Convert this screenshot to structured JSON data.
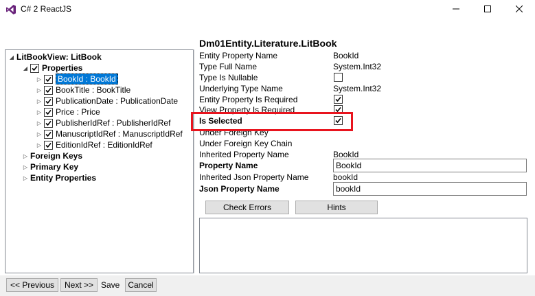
{
  "window": {
    "title": "C# 2 ReactJS",
    "app_icon": "visual-studio-icon",
    "controls": [
      "minimize-icon",
      "maximize-icon",
      "close-icon"
    ]
  },
  "tree": {
    "root_label": "LitBookView: LitBook",
    "properties_label": "Properties",
    "properties": [
      {
        "label": "BookId : BookId",
        "checked": true,
        "selected": true
      },
      {
        "label": "BookTitle : BookTitle",
        "checked": true
      },
      {
        "label": "PublicationDate : PublicationDate",
        "checked": true
      },
      {
        "label": "Price : Price",
        "checked": true
      },
      {
        "label": "PublisherIdRef : PublisherIdRef",
        "checked": true
      },
      {
        "label": "ManuscriptIdRef : ManuscriptIdRef",
        "checked": true
      },
      {
        "label": "EditionIdRef : EditionIdRef",
        "checked": true
      }
    ],
    "foreign_keys_label": "Foreign Keys",
    "primary_key_label": "Primary Key",
    "entity_properties_label": "Entity Properties"
  },
  "details": {
    "entity_title": "Dm01Entity.Literature.LitBook",
    "entity_property_name_label": "Entity Property Name",
    "entity_property_name_value": "BookId",
    "type_full_name_label": "Type Full Name",
    "type_full_name_value": "System.Int32",
    "type_is_nullable_label": "Type Is Nullable",
    "underlying_type_name_label": "Underlying Type Name",
    "underlying_type_name_value": "System.Int32",
    "entity_property_required_label": "Entity Property Is Required",
    "view_property_required_label": "View Property Is Required",
    "is_selected_label": "Is Selected",
    "under_foreign_key_label": "Under Foreign Key",
    "under_foreign_key_chain_label": "Under Foreign Key Chain",
    "inherited_property_name_label": "Inherited Property Name",
    "inherited_property_name_value": "BookId",
    "property_name_label": "Property Name",
    "property_name_value": "BookId",
    "inherited_json_property_name_label": "Inherited Json Property Name",
    "inherited_json_property_name_value": "bookId",
    "json_property_name_label": "Json Property Name",
    "json_property_name_value": "bookId"
  },
  "buttons": {
    "check_errors": "Check Errors",
    "hints": "Hints",
    "previous": "<< Previous",
    "next": "Next >>",
    "save": "Save",
    "cancel": "Cancel"
  },
  "colors": {
    "highlight": "#e8141e",
    "selection": "#0078d7"
  }
}
